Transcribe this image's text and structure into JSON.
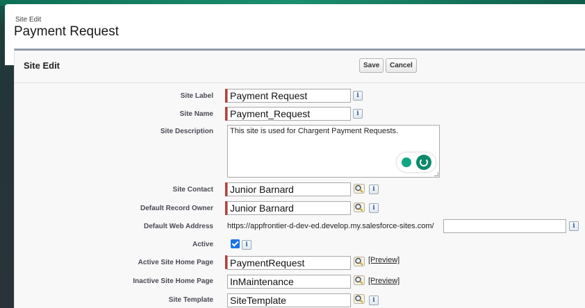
{
  "page": {
    "eyebrow": "Site Edit",
    "title": "Payment Request"
  },
  "panel": {
    "title": "Site Edit",
    "save_label": "Save",
    "cancel_label": "Cancel"
  },
  "fields": {
    "site_label": {
      "label": "Site Label",
      "value": "Payment Request"
    },
    "site_name": {
      "label": "Site Name",
      "value": "Payment_Request"
    },
    "site_description": {
      "label": "Site Description",
      "value": "This site is used for Chargent Payment Requests."
    },
    "site_contact": {
      "label": "Site Contact",
      "value": "Junior Barnard"
    },
    "default_record_owner": {
      "label": "Default Record Owner",
      "value": "Junior Barnard"
    },
    "default_web_address": {
      "label": "Default Web Address",
      "prefix": "https://appfrontier-d-dev-ed.develop.my.salesforce-sites.com/",
      "value": ""
    },
    "active": {
      "label": "Active",
      "checked": true
    },
    "active_home_page": {
      "label": "Active Site Home Page",
      "value": "PaymentRequest",
      "preview": "[Preview]"
    },
    "inactive_home_page": {
      "label": "Inactive Site Home Page",
      "value": "InMaintenance",
      "preview": "[Preview]"
    },
    "site_template": {
      "label": "Site Template",
      "value": "SiteTemplate"
    }
  },
  "info_glyph": "i",
  "icons": {
    "info": "info-icon",
    "lookup": "lookup-magnifier-icon",
    "grammar": "grammarly-icon"
  },
  "colors": {
    "required_marker": "#c23934",
    "checkbox": "#1a73e8",
    "panel_border": "#8e9aaa"
  }
}
